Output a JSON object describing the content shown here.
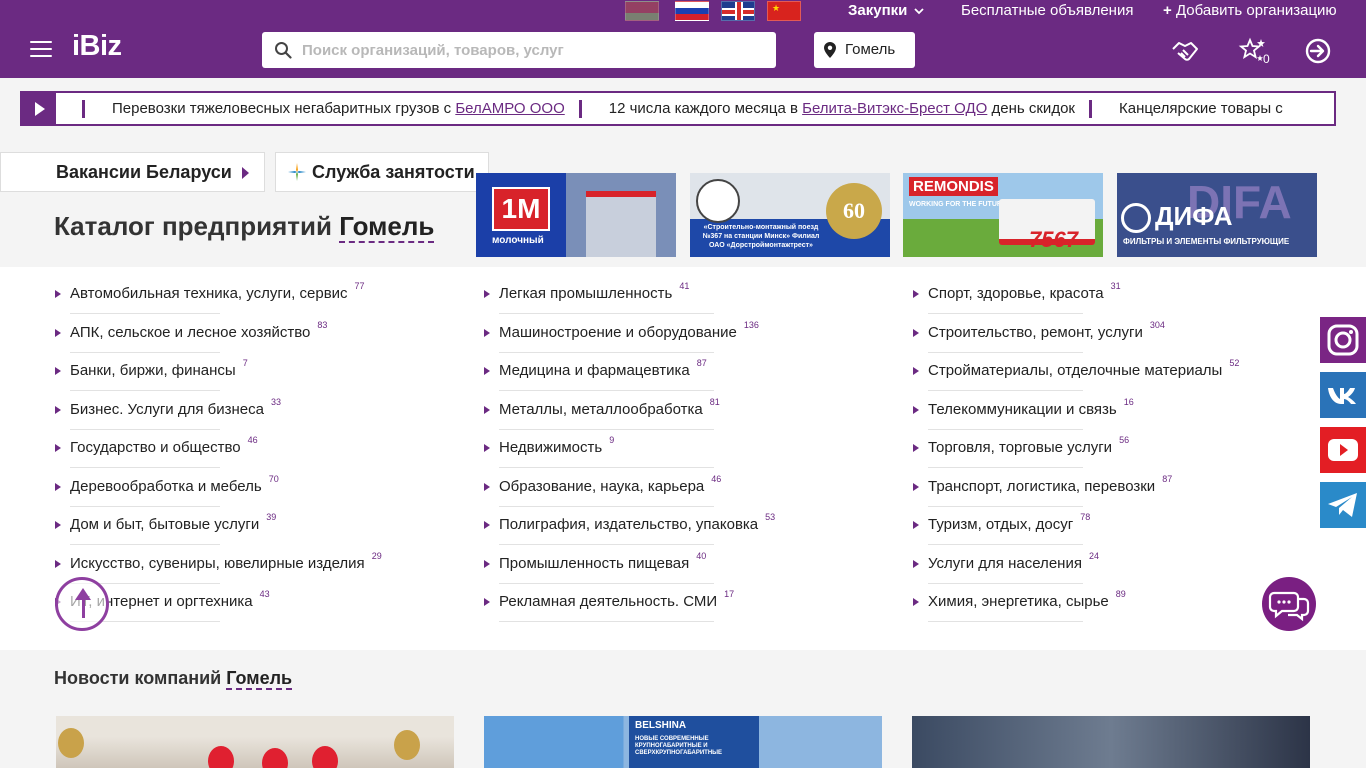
{
  "topbar": {
    "zakupki_label": "Закупки",
    "free_ads_label": "Бесплатные объявления",
    "add_org_label": "Добавить организацию"
  },
  "header": {
    "logo": "iBiz",
    "search_placeholder": "Поиск организаций, товаров, услуг",
    "city": "Гомель",
    "favorites_count": "0"
  },
  "ticker": [
    {
      "before": "Перевозки тяжеловесных негабаритных грузов с ",
      "link": "БелАМРО ООО",
      "after": ""
    },
    {
      "before": "12 числа каждого месяца в ",
      "link": "Белита-Витэкс-Брест ОДО",
      "after": " день скидок"
    },
    {
      "before": "Канцелярские товары с",
      "link": "",
      "after": ""
    }
  ],
  "tabs": {
    "vacancies": "Вакансии Беларуси",
    "employment": "Служба занятости"
  },
  "banners": {
    "b1_logo": "1M",
    "b1_caption": "молочный",
    "b2_caption": "«Строительно-монтажный поезд №367 на станции Минск» Филиал ОАО «Дорстроймонтажтрест»",
    "b2_years": "60",
    "b3_brand": "REMONDIS",
    "b3_sub": "WORKING FOR THE FUTURE",
    "b3_phone": "7567",
    "b4_ghost": "DIFA",
    "b4_brand": "ДИФА",
    "b4_caption": "ФИЛЬТРЫ И ЭЛЕМЕНТЫ ФИЛЬТРУЮЩИЕ"
  },
  "catalog": {
    "title_prefix": "Каталог предприятий",
    "city": "Гомель",
    "columns": [
      [
        {
          "name": "Автомобильная техника, услуги, сервис",
          "count": "77"
        },
        {
          "name": "АПК, сельское и лесное хозяйство",
          "count": "83"
        },
        {
          "name": "Банки, биржи, финансы",
          "count": "7"
        },
        {
          "name": "Бизнес. Услуги для бизнеса",
          "count": "33"
        },
        {
          "name": "Государство и общество",
          "count": "46"
        },
        {
          "name": "Деревообработка и мебель",
          "count": "70"
        },
        {
          "name": "Дом и быт, бытовые услуги",
          "count": "39"
        },
        {
          "name": "Искусство, сувениры, ювелирные изделия",
          "count": "29"
        },
        {
          "name": "ИТ, интернет и оргтехника",
          "count": "43"
        }
      ],
      [
        {
          "name": "Легкая промышленность",
          "count": "41"
        },
        {
          "name": "Машиностроение и оборудование",
          "count": "136"
        },
        {
          "name": "Медицина и фармацевтика",
          "count": "87"
        },
        {
          "name": "Металлы, металлообработка",
          "count": "81"
        },
        {
          "name": "Недвижимость",
          "count": "9"
        },
        {
          "name": "Образование, наука, карьера",
          "count": "46"
        },
        {
          "name": "Полиграфия, издательство, упаковка",
          "count": "53"
        },
        {
          "name": "Промышленность пищевая",
          "count": "40"
        },
        {
          "name": "Рекламная деятельность. СМИ",
          "count": "17"
        }
      ],
      [
        {
          "name": "Спорт, здоровье, красота",
          "count": "31"
        },
        {
          "name": "Строительство, ремонт, услуги",
          "count": "304"
        },
        {
          "name": "Стройматериалы, отделочные материалы",
          "count": "52"
        },
        {
          "name": "Телекоммуникации и связь",
          "count": "16"
        },
        {
          "name": "Торговля, торговые услуги",
          "count": "56"
        },
        {
          "name": "Транспорт, логистика, перевозки",
          "count": "87"
        },
        {
          "name": "Туризм, отдых, досуг",
          "count": "78"
        },
        {
          "name": "Услуги для населения",
          "count": "24"
        },
        {
          "name": "Химия, энергетика, сырье",
          "count": "89"
        }
      ]
    ]
  },
  "news": {
    "title_prefix": "Новости компаний",
    "city": "Гомель",
    "card2_brand": "BELSHINA",
    "card2_text": "НОВЫЕ СОВРЕМЕННЫЕ КРУПНОГАБАРИТНЫЕ И СВЕРХКРУПНОГАБАРИТНЫЕ"
  },
  "icons": {
    "search": "search-icon",
    "pin": "map-pin-icon",
    "handshake": "handshake-icon",
    "favorites": "stars-icon",
    "login": "login-icon",
    "instagram": "instagram-icon",
    "vk": "vk-icon",
    "youtube": "youtube-icon",
    "telegram": "telegram-icon",
    "chat": "chat-icon",
    "scroll_up": "arrow-up-icon"
  },
  "colors": {
    "brand": "#6b2a82",
    "instagram": "#7a2584",
    "vk": "#2a73b8",
    "youtube": "#e31e24",
    "telegram": "#2a8ac9"
  }
}
